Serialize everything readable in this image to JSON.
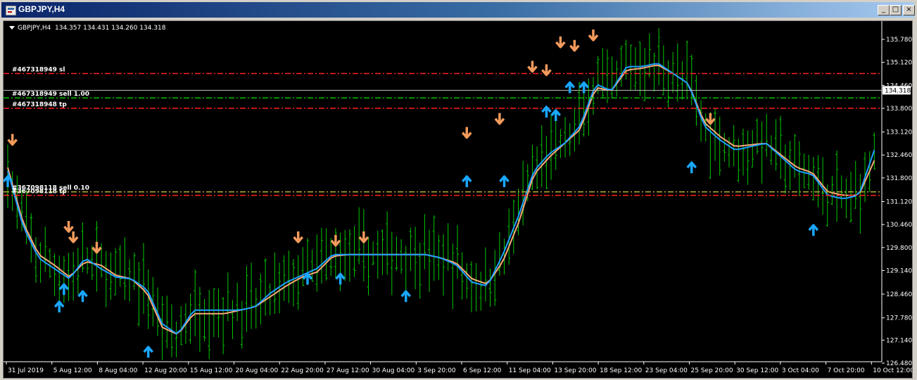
{
  "window": {
    "title": "GBPJPY,H4",
    "buttons": {
      "minimize": "_",
      "maximize": "□",
      "close": "×"
    }
  },
  "chart_info": {
    "symbol_tf": "GBPJPY,H4",
    "ohlc": "134.357 134.431 134.260 134.318"
  },
  "chart_data": {
    "type": "line",
    "title": "",
    "symbol": "GBPJPY",
    "timeframe": "H4",
    "ylim": [
      126.48,
      136.1
    ],
    "y_ticks": [
      "135.780",
      "135.120",
      "134.460",
      "133.800",
      "133.120",
      "132.460",
      "131.800",
      "131.120",
      "130.460",
      "129.800",
      "129.140",
      "128.460",
      "127.780",
      "127.140",
      "126.480"
    ],
    "x_labels": [
      "31 Jul 2019",
      "5 Aug 12:00",
      "8 Aug 04:00",
      "12 Aug 20:00",
      "15 Aug 12:00",
      "20 Aug 04:00",
      "22 Aug 20:00",
      "27 Aug 12:00",
      "30 Aug 04:00",
      "3 Sep 20:00",
      "6 Sep 12:00",
      "11 Sep 04:00",
      "13 Sep 20:00",
      "18 Sep 12:00",
      "23 Sep 04:00",
      "25 Sep 20:00",
      "30 Sep 12:00",
      "3 Oct 04:00",
      "7 Oct 20:00",
      "10 Oct 12:00"
    ],
    "current_price": "134.318",
    "series": [
      {
        "values": [
          132.0,
          130.4,
          129.5,
          129.2,
          128.9,
          129.5,
          129.2,
          128.95,
          128.9,
          128.6,
          127.6,
          127.3,
          128.0,
          128.0,
          128.0,
          128.0,
          128.1,
          128.5,
          128.8,
          129.0,
          129.2,
          129.6,
          129.6,
          129.6,
          129.6,
          129.6,
          129.6,
          129.6,
          129.5,
          129.3,
          128.8,
          128.7,
          129.6,
          130.7,
          132.0,
          132.5,
          132.8,
          133.3,
          134.5,
          134.3,
          135.0,
          135.0,
          135.1,
          134.8,
          134.5,
          133.3,
          132.9,
          132.6,
          132.7,
          132.8,
          132.4,
          132.0,
          131.9,
          131.3,
          131.2,
          131.3,
          132.6
        ]
      },
      {
        "values": [
          132.1,
          130.5,
          129.6,
          129.3,
          128.95,
          129.4,
          129.3,
          129.0,
          128.9,
          128.5,
          127.5,
          127.3,
          127.9,
          127.9,
          127.9,
          128.0,
          128.1,
          128.4,
          128.7,
          128.95,
          129.1,
          129.55,
          129.6,
          129.6,
          129.6,
          129.6,
          129.6,
          129.6,
          129.5,
          129.35,
          128.9,
          128.75,
          129.4,
          130.5,
          131.9,
          132.4,
          132.8,
          133.2,
          134.4,
          134.3,
          134.9,
          134.95,
          135.05,
          134.8,
          134.5,
          133.4,
          133.0,
          132.7,
          132.75,
          132.8,
          132.45,
          132.1,
          131.95,
          131.4,
          131.3,
          131.3,
          132.3
        ]
      }
    ],
    "orders": [
      {
        "text": "#467318949 sl",
        "price": 134.8,
        "color": "#ff2020"
      },
      {
        "text": "#467318949 sell 1.00",
        "price": 134.1,
        "color": "#00c000"
      },
      {
        "text": "#467318948 tp",
        "price": 133.8,
        "color": "#ff2020"
      },
      {
        "text": "#367098118 sell 0.10",
        "price": 131.4,
        "color": "#b8b038"
      },
      {
        "text": "#367098118 tp",
        "price": 131.3,
        "color": "#ff2020"
      }
    ],
    "buy_arrows": [
      [
        0,
        131.9
      ],
      [
        11,
        128.3
      ],
      [
        12,
        128.8
      ],
      [
        16,
        128.6
      ],
      [
        30,
        127.0
      ],
      [
        64,
        129.1
      ],
      [
        71,
        129.1
      ],
      [
        85,
        128.6
      ],
      [
        98,
        131.9
      ],
      [
        106,
        131.9
      ],
      [
        115,
        133.9
      ],
      [
        117,
        133.8
      ],
      [
        120,
        134.6
      ],
      [
        123,
        134.6
      ],
      [
        146,
        132.3
      ],
      [
        172,
        130.5
      ]
    ],
    "sell_arrows": [
      [
        1,
        132.7
      ],
      [
        13,
        130.2
      ],
      [
        14,
        129.9
      ],
      [
        19,
        129.6
      ],
      [
        62,
        129.9
      ],
      [
        70,
        129.8
      ],
      [
        76,
        129.9
      ],
      [
        98,
        132.9
      ],
      [
        105,
        133.3
      ],
      [
        112,
        134.8
      ],
      [
        115,
        134.7
      ],
      [
        118,
        135.5
      ],
      [
        121,
        135.4
      ],
      [
        125,
        135.7
      ],
      [
        150,
        133.3
      ]
    ],
    "colors": {
      "background": "#000000",
      "candles": "#00c800",
      "fast_line": "#1e9fff",
      "slow_line": "#f6a878",
      "buy_arrow": "#1aa7ff",
      "sell_arrow": "#f39a5c",
      "price_line": "#c0c0c0"
    }
  }
}
